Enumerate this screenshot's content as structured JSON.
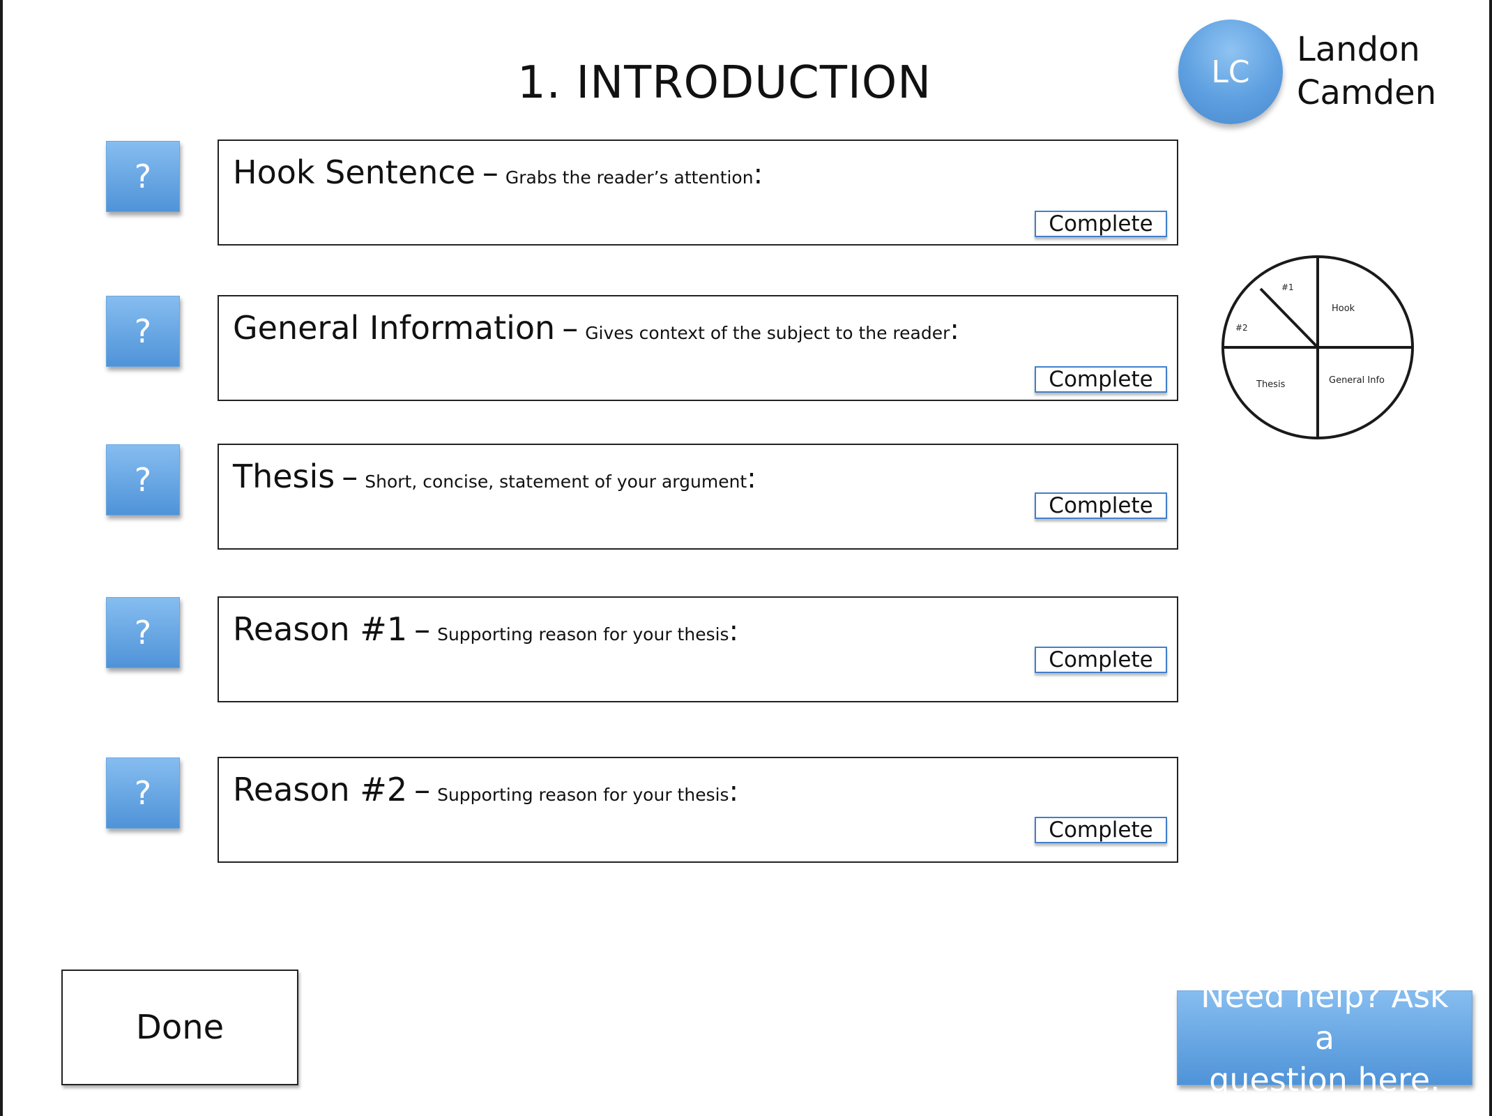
{
  "page": {
    "title": "1. INTRODUCTION"
  },
  "user": {
    "initials": "LC",
    "first_name": "Landon",
    "last_name": "Camden"
  },
  "help_square_label": "?",
  "sections": [
    {
      "title": "Hook Sentence",
      "dash": "–",
      "description": "Grabs the reader’s attention",
      "colon": ":",
      "complete_label": "Complete"
    },
    {
      "title": "General Information",
      "dash": "–",
      "description": "Gives context of the subject to the reader",
      "colon": ":",
      "complete_label": "Complete"
    },
    {
      "title": "Thesis",
      "dash": "–",
      "description": "Short, concise, statement of your argument",
      "colon": ":",
      "complete_label": "Complete"
    },
    {
      "title": "Reason #1",
      "dash": "–",
      "description": "Supporting reason for your thesis",
      "colon": ":",
      "complete_label": "Complete"
    },
    {
      "title": "Reason #2",
      "dash": "–",
      "description": "Supporting reason for your thesis",
      "colon": ":",
      "complete_label": "Complete"
    }
  ],
  "progress_chart": {
    "labels": {
      "hook": "Hook",
      "general_info": "General Info",
      "thesis": "Thesis",
      "reason_1": "#1",
      "reason_2": "#2"
    }
  },
  "done_label": "Done",
  "help": {
    "line1": "Need help? Ask a",
    "line2": "question here."
  }
}
